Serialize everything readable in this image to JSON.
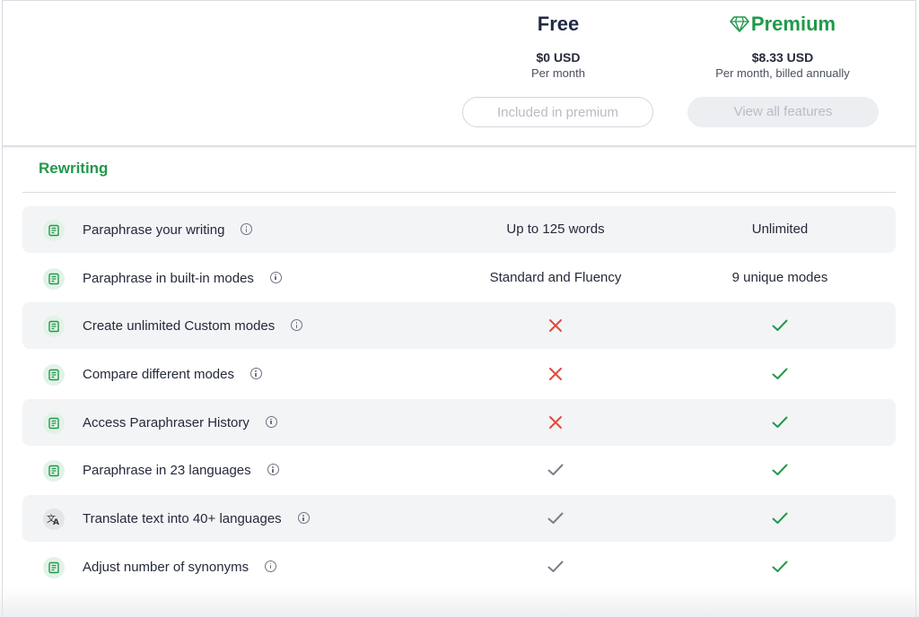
{
  "plans": {
    "free": {
      "name": "Free",
      "price": "$0 USD",
      "period": "Per month",
      "button": "Included in premium"
    },
    "premium": {
      "name": "Premium",
      "icon": "diamond-icon",
      "price": "$8.33 USD",
      "period": "Per month, billed annually",
      "button": "View all features"
    }
  },
  "colors": {
    "accent_green": "#21994a",
    "cross_red": "#e2493d",
    "check_gray": "#7a7f8a",
    "row_shade": "#f3f4f6"
  },
  "section": {
    "title": "Rewriting"
  },
  "features": [
    {
      "label": "Paraphrase your writing",
      "icon": "paraphraser-icon",
      "free": "Up to 125 words",
      "premium": "Unlimited"
    },
    {
      "label": "Paraphrase in built-in modes",
      "icon": "paraphraser-icon",
      "free": "Standard and Fluency",
      "premium": "9 unique modes"
    },
    {
      "label": "Create unlimited Custom modes",
      "icon": "paraphraser-icon",
      "free": "cross",
      "premium": "check"
    },
    {
      "label": "Compare different modes",
      "icon": "paraphraser-icon",
      "free": "cross",
      "premium": "check"
    },
    {
      "label": "Access Paraphraser History",
      "icon": "paraphraser-icon",
      "free": "cross",
      "premium": "check"
    },
    {
      "label": "Paraphrase in 23 languages",
      "icon": "paraphraser-icon",
      "free": "check-gray",
      "premium": "check"
    },
    {
      "label": "Translate text into 40+ languages",
      "icon": "translate-icon",
      "free": "check-gray",
      "premium": "check"
    },
    {
      "label": "Adjust number of synonyms",
      "icon": "paraphraser-icon",
      "free": "check-gray",
      "premium": "check"
    }
  ]
}
